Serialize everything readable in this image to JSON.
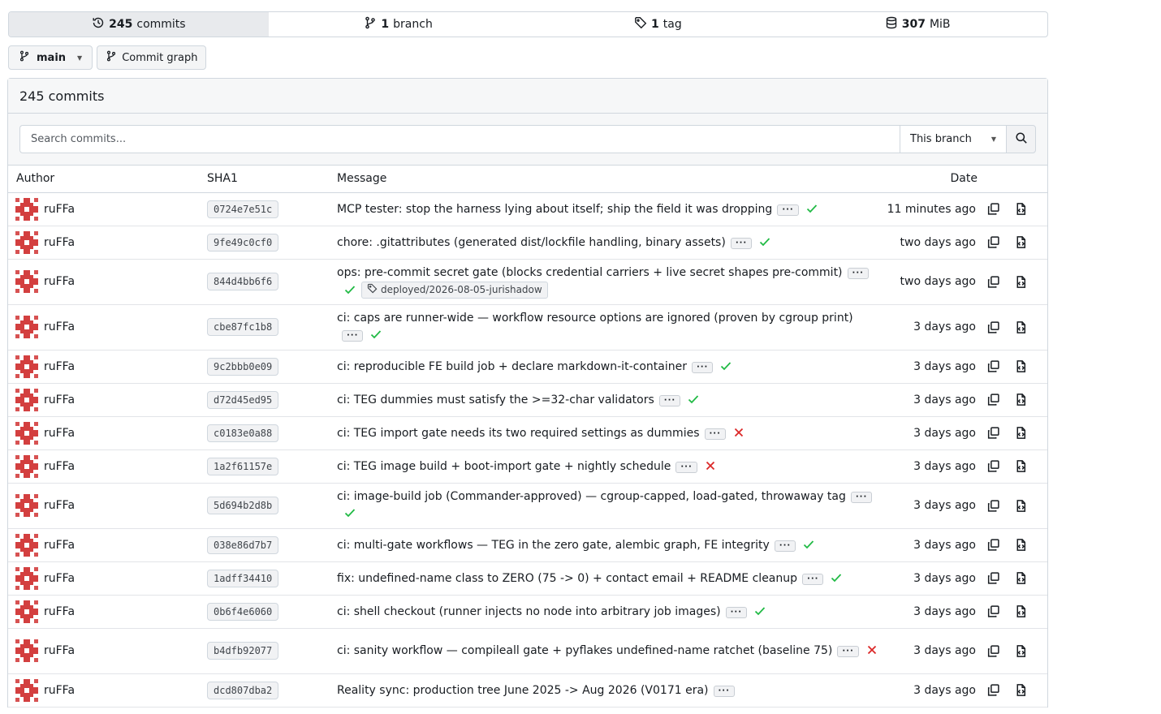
{
  "stats": {
    "commits_count": "245",
    "commits_label": "commits",
    "branches_count": "1",
    "branches_label": "branch",
    "tags_count": "1",
    "tags_label": "tag",
    "size_value": "307",
    "size_unit": "MiB"
  },
  "toolbar": {
    "branch_name": "main",
    "commit_graph_label": "Commit graph"
  },
  "panel": {
    "title": "245 commits",
    "search_placeholder": "Search commits...",
    "scope_label": "This branch"
  },
  "table": {
    "headers": {
      "author": "Author",
      "sha": "SHA1",
      "message": "Message",
      "date": "Date"
    },
    "rows": [
      {
        "author": "ruFFa",
        "sha": "0724e7e51c",
        "message": "MCP tester: stop the harness lying about itself; ship the field it was dropping",
        "status": "success",
        "date": "11 minutes ago"
      },
      {
        "author": "ruFFa",
        "sha": "9fe49c0cf0",
        "message": "chore: .gitattributes (generated dist/lockfile handling, binary assets)",
        "status": "success",
        "date": "two days ago"
      },
      {
        "author": "ruFFa",
        "sha": "844d4bb6f6",
        "message": "ops: pre-commit secret gate (blocks credential carriers + live secret shapes pre-commit)",
        "status": "success",
        "tag": "deployed/2026-08-05-jurishadow",
        "date": "two days ago"
      },
      {
        "author": "ruFFa",
        "sha": "cbe87fc1b8",
        "message": "ci: caps are runner-wide — workflow resource options are ignored (proven by cgroup print)",
        "status": "success",
        "date": "3 days ago"
      },
      {
        "author": "ruFFa",
        "sha": "9c2bbb0e09",
        "message": "ci: reproducible FE build job + declare markdown-it-container",
        "status": "success",
        "date": "3 days ago"
      },
      {
        "author": "ruFFa",
        "sha": "d72d45ed95",
        "message": "ci: TEG dummies must satisfy the >=32-char validators",
        "status": "success",
        "date": "3 days ago"
      },
      {
        "author": "ruFFa",
        "sha": "c0183e0a88",
        "message": "ci: TEG import gate needs its two required settings as dummies",
        "status": "failure",
        "date": "3 days ago"
      },
      {
        "author": "ruFFa",
        "sha": "1a2f61157e",
        "message": "ci: TEG image build + boot-import gate + nightly schedule",
        "status": "failure",
        "date": "3 days ago"
      },
      {
        "author": "ruFFa",
        "sha": "5d694b2d8b",
        "message": "ci: image-build job (Commander-approved) — cgroup-capped, load-gated, throwaway tag",
        "status": "success",
        "date": "3 days ago"
      },
      {
        "author": "ruFFa",
        "sha": "038e86d7b7",
        "message": "ci: multi-gate workflows — TEG in the zero gate, alembic graph, FE integrity",
        "status": "success",
        "date": "3 days ago"
      },
      {
        "author": "ruFFa",
        "sha": "1adff34410",
        "message": "fix: undefined-name class to ZERO (75 -> 0) + contact email + README cleanup",
        "status": "success",
        "date": "3 days ago"
      },
      {
        "author": "ruFFa",
        "sha": "0b6f4e6060",
        "message": "ci: shell checkout (runner injects no node into arbitrary job images)",
        "status": "success",
        "date": "3 days ago"
      },
      {
        "author": "ruFFa",
        "sha": "b4dfb92077",
        "message": "ci: sanity workflow — compileall gate + pyflakes undefined-name ratchet (baseline 75)",
        "status": "failure",
        "date": "3 days ago"
      },
      {
        "author": "ruFFa",
        "sha": "dcd807dba2",
        "message": "Reality sync: production tree June 2025 -> Aug 2026 (V0171 era)",
        "status": "none",
        "date": "3 days ago"
      }
    ]
  },
  "colors": {
    "success": "#21ba45",
    "failure": "#db2828",
    "avatar": "#d33f3f"
  },
  "icons": {
    "commits": "history-icon",
    "branch": "git-branch-icon",
    "tag": "tag-icon",
    "size": "database-icon",
    "search": "search-icon",
    "copy": "copy-icon",
    "browse": "file-code-icon"
  }
}
